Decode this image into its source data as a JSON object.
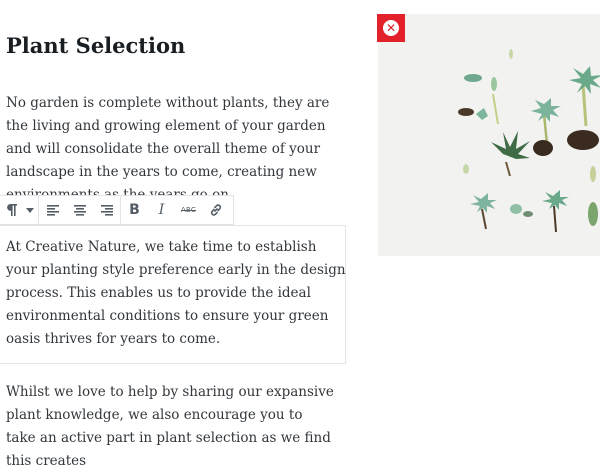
{
  "heading": "Plant Selection",
  "paragraphs": {
    "p1": "No garden is complete without plants, they are the living and growing element of your garden and will consolidate the overall theme of your landscape in the years to come, creating new environments as the years go on.",
    "p2": "At Creative Nature, we take time to establish your planting style preference early in the design process. This enables us to provide the ideal environmental conditions to ensure your green oasis thrives for years to come.",
    "p3": "Whilst we love to help by sharing our expansive plant knowledge, we also encourage you to take an active part in plant selection as we find this creates"
  },
  "toolbar": {
    "paragraph_icon": "pilcrow-icon",
    "buttons": [
      "align-left-icon",
      "align-center-icon",
      "align-right-icon",
      "bold-icon",
      "italic-icon",
      "strikethrough-icon",
      "link-icon"
    ],
    "bold_label": "B",
    "italic_label": "I",
    "strike_label": "ABC"
  },
  "image": {
    "subject": "succulent plants on white background",
    "remove_icon": "close-icon"
  },
  "colors": {
    "remove_button": "#e2212a",
    "text": "#32373c"
  }
}
